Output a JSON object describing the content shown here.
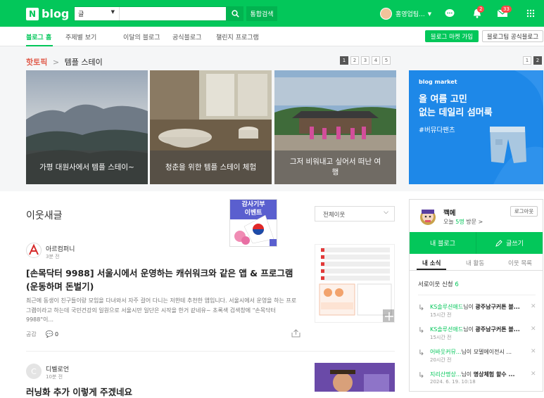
{
  "header": {
    "logo_n": "N",
    "logo_text": "blog",
    "search_scope": "글",
    "search_placeholder": "",
    "search_button": "search-icon",
    "unified_search": "통합검색",
    "user_name": "홍영업팀...",
    "notification_count": "2",
    "message_count": "33",
    "colors": {
      "brand": "#03c75a"
    }
  },
  "subnav": {
    "items": [
      "블로그 홈",
      "주제별 보기",
      "이달의 블로그",
      "공식블로그",
      "챌린지 프로그램"
    ],
    "market_button": "블로그 마켓 가입",
    "official_button": "블로그팀 공식블로그"
  },
  "hot": {
    "label": "핫토픽",
    "sep": ">",
    "topic": "템플 스테이",
    "pages": [
      "1",
      "2",
      "3",
      "4",
      "5"
    ],
    "ad_pages": [
      "1",
      "2"
    ],
    "cards": [
      {
        "caption": "가평 대원사에서 템플 스테이~"
      },
      {
        "caption": "청춘을 위한 템플 스테이 체험"
      },
      {
        "caption": "그저 비워내고 싶어서 떠난 여행"
      }
    ],
    "ad": {
      "brand": "blog market",
      "line1": "올 여름 고민",
      "line2": "없는 데일리 섬머룩",
      "tag": "#버뮤다팬츠"
    }
  },
  "feed": {
    "title": "이웃새글",
    "filter": "전체이웃",
    "promo_lines": [
      "감사기부",
      "이벤트"
    ],
    "posts": [
      {
        "author": "아르컴퍼니",
        "time": "3분 전",
        "title": "[손목닥터 9988] 서울시에서 운영하는 캐쉬워크와 같은 앱 & 프로그램(운동하며 돈벌기)",
        "excerpt": "최근에 동생이 친구들이랑 모임을 다녀와서 자주 걸어 다니는 저한테 추천한 앱입니다. 서울시에서 운영을 하는 프로그램이라고 하는데 국민건강의 일원으로 서울시만 일단은 시작을 한거 같네유~ 초록색 검색창에 \"손목닥터 9988\"이...",
        "like": "공감",
        "comments": "0"
      },
      {
        "author": "디벨로언",
        "time": "10분 전",
        "title": "러닝화 추가 이렇게 주겠네요"
      }
    ]
  },
  "panel": {
    "name": "깩메",
    "visit_pre": "오늘",
    "visit_count": "5명",
    "visit_post": "방문 >",
    "logout": "로그아웃",
    "my_blog": "내 블로그",
    "write": "글쓰기",
    "tabs": [
      "내 소식",
      "내 활동",
      "이웃 목록"
    ],
    "status_pre": "서로이웃 신청",
    "status_count": "6",
    "news": [
      {
        "who": "KS솔루션애드",
        "rest": "님이",
        "what": "광주남구커튼 블...",
        "time": "15시간 전"
      },
      {
        "who": "KS솔루션애드",
        "rest": "님이",
        "what": "광주남구커튼 블...",
        "time": "15시간 전"
      },
      {
        "who": "어바웃커뮤...",
        "rest": "님이 모델에이전시 ...",
        "what": "",
        "time": "20시간 전"
      },
      {
        "who": "지리산명상...",
        "rest": "님이",
        "what": "명상체험 할수 ...",
        "time": "2024. 6. 19. 10:18"
      }
    ]
  }
}
